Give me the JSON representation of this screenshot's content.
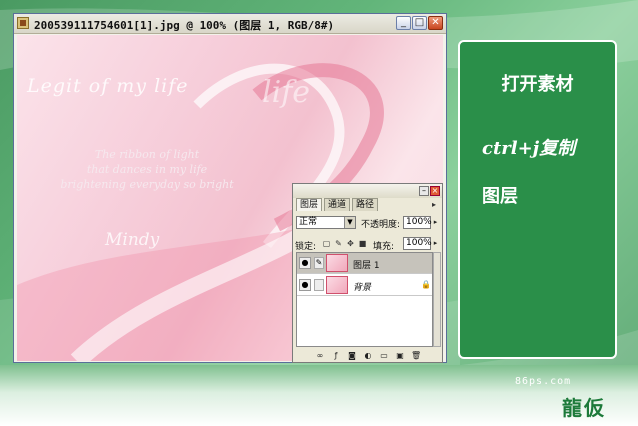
{
  "window": {
    "title": "200539111754601[1].jpg @ 100% (图层 1, RGB/8#)",
    "buttons": {
      "minimize": "_",
      "maximize": "□",
      "close": "✕"
    }
  },
  "canvas_image": {
    "script_line": "Legit of my life",
    "script_big": "life",
    "poem": [
      "The ribbon of light",
      "that dances in my life",
      "brightening everyday so bright"
    ],
    "signature": "Mindy"
  },
  "layers_panel": {
    "tabs": [
      "图层",
      "通道",
      "路径"
    ],
    "blend_mode": "正常",
    "opacity_label": "不透明度:",
    "opacity_value": "100%",
    "lock_label": "锁定:",
    "fill_label": "填充:",
    "fill_value": "100%",
    "layers": [
      {
        "name": "图层 1",
        "selected": true,
        "locked": false
      },
      {
        "name": "背景",
        "selected": false,
        "locked": true
      }
    ]
  },
  "note_card": {
    "line1": "打开素材",
    "line2": "ctrl+j复制",
    "line3": "图层"
  },
  "footer": {
    "watermark": "86ps.com",
    "logo": "龍仮"
  }
}
